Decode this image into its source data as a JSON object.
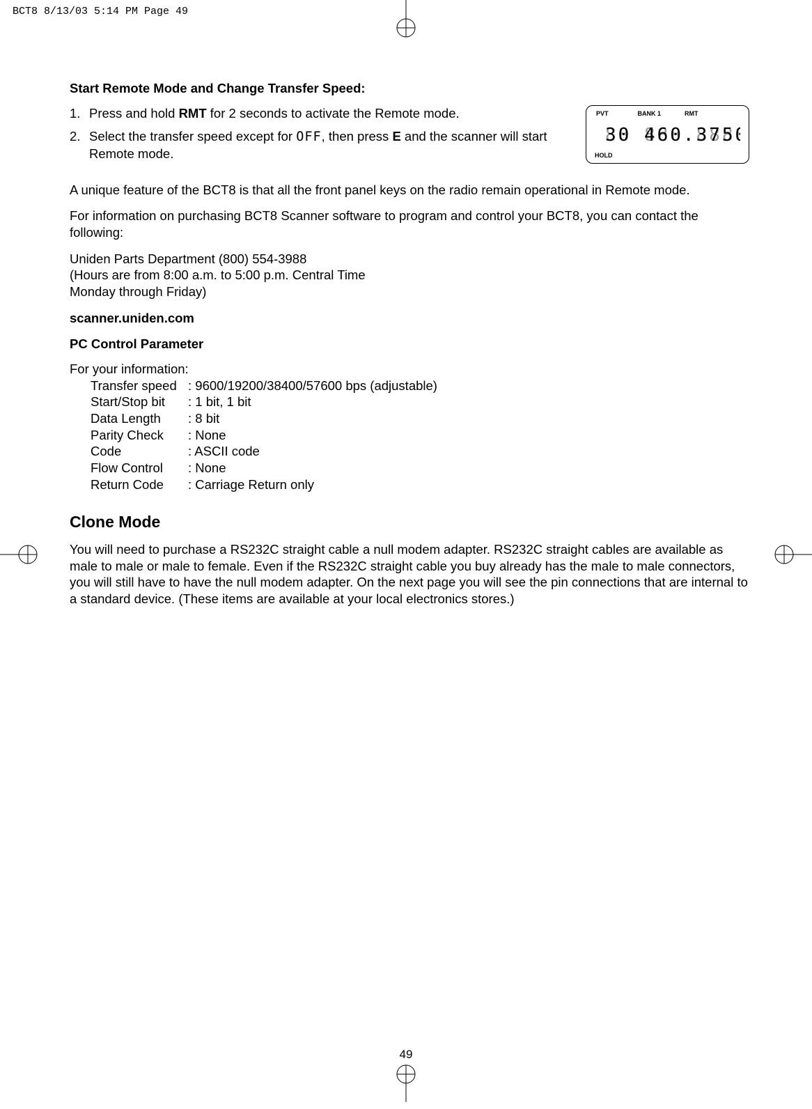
{
  "header": {
    "filename_line": "BCT8  8/13/03 5:14 PM  Page 49"
  },
  "section1": {
    "heading": "Start Remote Mode and Change Transfer Speed:",
    "step1_num": "1.",
    "step1_a": "Press and hold ",
    "step1_bold": "RMT",
    "step1_b": " for 2 seconds to activate the Remote mode.",
    "step2_num": "2.",
    "step2_a": "Select the transfer speed except for ",
    "step2_seg": "OFF",
    "step2_b": ", then press ",
    "step2_bold": "E",
    "step2_c": " and the scanner will start Remote mode."
  },
  "lcd": {
    "pvt": "PVT",
    "bank": "BANK 1",
    "rmt": "RMT",
    "hold": "HOLD"
  },
  "para1": "A unique feature of the BCT8 is that all the front panel keys on the radio remain operational in Remote mode.",
  "para2": "For information on purchasing BCT8 Scanner software to program and control your BCT8, you can contact the following:",
  "contact": {
    "line1": "Uniden Parts Department (800) 554-3988",
    "line2": "(Hours are from 8:00 a.m. to 5:00 p.m. Central Time",
    "line3": "Monday through Friday)"
  },
  "url": "scanner.uniden.com",
  "pcparam": {
    "heading": "PC Control Parameter",
    "intro": "For your information:",
    "rows": [
      {
        "label": "Transfer speed",
        "value": ": 9600/19200/38400/57600 bps (adjustable)"
      },
      {
        "label": "Start/Stop bit",
        "value": ": 1 bit, 1 bit"
      },
      {
        "label": "Data Length",
        "value": ": 8 bit"
      },
      {
        "label": "Parity Check",
        "value": ": None"
      },
      {
        "label": "Code",
        "value": ": ASCII code"
      },
      {
        "label": "Flow Control",
        "value": ": None"
      },
      {
        "label": "Return Code",
        "value": ": Carriage Return only"
      }
    ]
  },
  "clone": {
    "heading": "Clone Mode",
    "text": "You will need to purchase a RS232C straight cable a null modem adapter. RS232C straight cables are available as male to male or male to female. Even if the RS232C straight cable you buy already has the male to male connectors, you will still have to have the null modem adapter. On the next page you will see the pin connections that are internal to a standard device. (These items are available at your local electronics stores.)"
  },
  "page_number": "49"
}
